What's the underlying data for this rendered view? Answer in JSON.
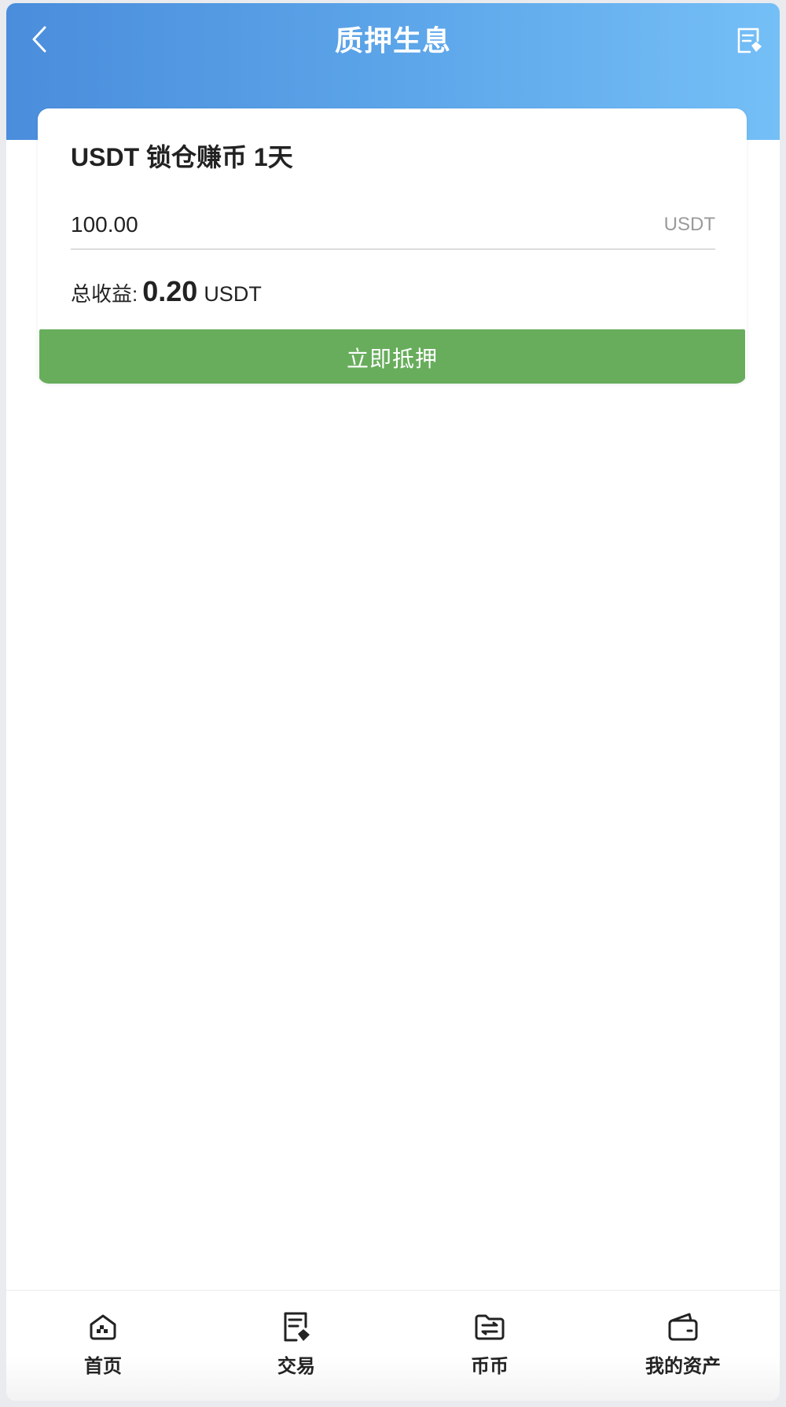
{
  "header": {
    "title": "质押生息",
    "back_icon": "chevron-left-icon",
    "records_icon": "document-icon"
  },
  "product": {
    "title": "USDT 锁仓赚币 1天",
    "amount_value": "100.00",
    "amount_unit": "USDT",
    "income_label": "总收益:",
    "income_value": "0.20",
    "income_unit": "USDT",
    "submit_label": "立即抵押"
  },
  "tabbar": {
    "items": [
      {
        "label": "首页",
        "icon": "home-icon"
      },
      {
        "label": "交易",
        "icon": "document-icon"
      },
      {
        "label": "币币",
        "icon": "folder-exchange-icon"
      },
      {
        "label": "我的资产",
        "icon": "wallet-icon"
      }
    ]
  },
  "colors": {
    "header_gradient_start": "#4a8ddc",
    "header_gradient_end": "#75bff7",
    "primary_button": "#68ad5c"
  }
}
